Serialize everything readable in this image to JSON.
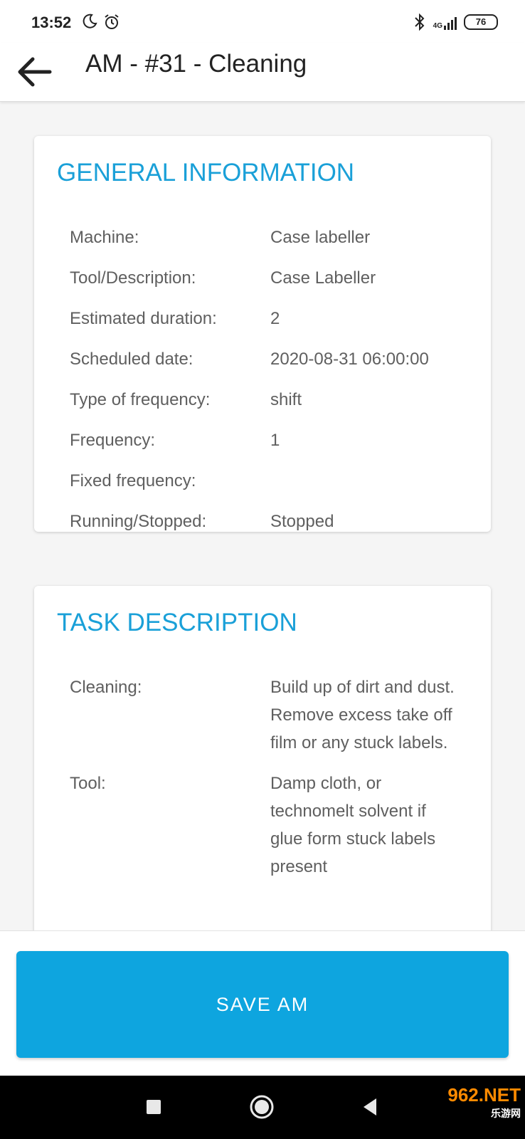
{
  "status_bar": {
    "time": "13:52",
    "network": "4G",
    "battery": "76",
    "icons": [
      "moon-icon",
      "alarm-icon",
      "bluetooth-icon",
      "signal-icon",
      "battery-icon"
    ]
  },
  "app_bar": {
    "title": "AM - #31 - Cleaning",
    "back_icon": "arrow-left-icon"
  },
  "general_information": {
    "title": "GENERAL INFORMATION",
    "rows": [
      {
        "label": "Machine:",
        "value": "Case labeller"
      },
      {
        "label": "Tool/Description:",
        "value": "Case Labeller"
      },
      {
        "label": "Estimated duration:",
        "value": "2"
      },
      {
        "label": "Scheduled date:",
        "value": "2020-08-31 06:00:00"
      },
      {
        "label": "Type of frequency:",
        "value": "shift"
      },
      {
        "label": "Frequency:",
        "value": "1"
      },
      {
        "label": "Fixed frequency:",
        "value": ""
      },
      {
        "label": "Running/Stopped:",
        "value": "Stopped"
      }
    ]
  },
  "task_description": {
    "title": "TASK DESCRIPTION",
    "rows": [
      {
        "label": "Cleaning:",
        "value": "Build up of dirt and dust. Remove excess take off film or any stuck labels."
      },
      {
        "label": "Tool:",
        "value": "Damp cloth, or technomelt solvent if glue form stuck labels present"
      }
    ]
  },
  "save_button": {
    "label": "SAVE AM"
  },
  "nav_bar": {
    "icons": [
      "recent-apps-icon",
      "home-icon",
      "back-icon"
    ]
  },
  "watermark": {
    "brand": "962.NET",
    "sub": "乐游网"
  },
  "colors": {
    "accent": "#1aa0d8",
    "button": "#0ea5df"
  }
}
